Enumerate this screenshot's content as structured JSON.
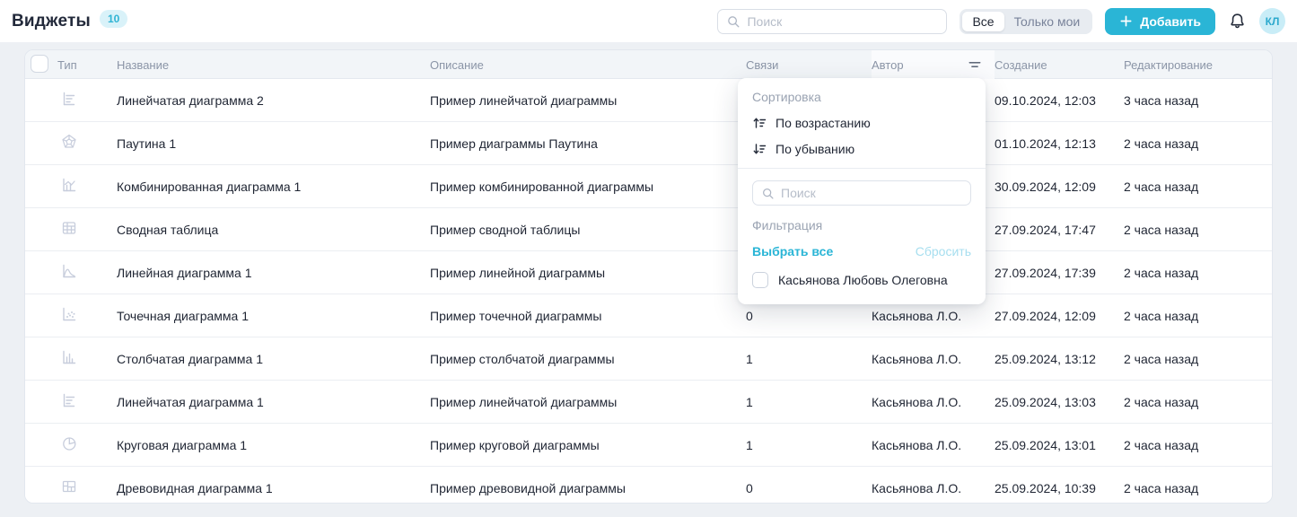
{
  "page": {
    "title": "Виджеты",
    "count_badge": "10"
  },
  "topbar": {
    "search_placeholder": "Поиск",
    "segmented": {
      "all": "Все",
      "only_mine": "Только мои",
      "active": "Все"
    },
    "add_button": "Добавить",
    "avatar_initials": "КЛ"
  },
  "table": {
    "columns": [
      "Тип",
      "Название",
      "Описание",
      "Связи",
      "Автор",
      "Создание",
      "Редактирование"
    ],
    "rows": [
      {
        "icon": "bar-horizontal-chart-icon",
        "name": "Линейчатая диаграмма 2",
        "description": "Пример линейчатой диаграммы",
        "links": "",
        "author": "",
        "created": "09.10.2024, 12:03",
        "edited": "3 часа назад"
      },
      {
        "icon": "radar-chart-icon",
        "name": "Паутина 1",
        "description": "Пример диаграммы Паутина",
        "links": "",
        "author": "",
        "created": "01.10.2024, 12:13",
        "edited": "2 часа назад"
      },
      {
        "icon": "combo-chart-icon",
        "name": "Комбинированная диаграмма 1",
        "description": "Пример комбинированной диаграммы",
        "links": "",
        "author": "",
        "created": "30.09.2024, 12:09",
        "edited": "2 часа назад"
      },
      {
        "icon": "pivot-table-icon",
        "name": "Сводная таблица",
        "description": "Пример сводной таблицы",
        "links": "",
        "author": "",
        "created": "27.09.2024, 17:47",
        "edited": "2 часа назад"
      },
      {
        "icon": "line-chart-icon",
        "name": "Линейная диаграмма 1",
        "description": "Пример линейной диаграммы",
        "links": "",
        "author": "",
        "created": "27.09.2024, 17:39",
        "edited": "2 часа назад"
      },
      {
        "icon": "scatter-chart-icon",
        "name": "Точечная диаграмма 1",
        "description": "Пример точечной диаграммы",
        "links": "0",
        "author": "Касьянова Л.О.",
        "created": "27.09.2024, 12:09",
        "edited": "2 часа назад"
      },
      {
        "icon": "bar-vertical-chart-icon",
        "name": "Столбчатая диаграмма 1",
        "description": "Пример столбчатой диаграммы",
        "links": "1",
        "author": "Касьянова Л.О.",
        "created": "25.09.2024, 13:12",
        "edited": "2 часа назад"
      },
      {
        "icon": "bar-horizontal-chart-icon",
        "name": "Линейчатая диаграмма 1",
        "description": "Пример линейчатой диаграммы",
        "links": "1",
        "author": "Касьянова Л.О.",
        "created": "25.09.2024, 13:03",
        "edited": "2 часа назад"
      },
      {
        "icon": "pie-chart-icon",
        "name": "Круговая диаграмма 1",
        "description": "Пример круговой диаграммы",
        "links": "1",
        "author": "Касьянова Л.О.",
        "created": "25.09.2024, 13:01",
        "edited": "2 часа назад"
      },
      {
        "icon": "treemap-chart-icon",
        "name": "Древовидная диаграмма 1",
        "description": "Пример древовидной диаграммы",
        "links": "0",
        "author": "Касьянова Л.О.",
        "created": "25.09.2024, 10:39",
        "edited": "2 часа назад"
      }
    ]
  },
  "filter_dropdown": {
    "sort_label": "Сортировка",
    "sort_asc": "По возрастанию",
    "sort_desc": "По убыванию",
    "search_placeholder": "Поиск",
    "filter_label": "Фильтрация",
    "select_all": "Выбрать все",
    "reset": "Сбросить",
    "options": [
      {
        "label": "Касьянова Любовь Олеговна",
        "checked": false
      }
    ]
  },
  "colors": {
    "accent": "#2AB5D6",
    "accent_light": "#D9F2F9",
    "reset_disabled": "#A6DEEF",
    "header_text": "#8B95A7",
    "body_text": "#1F2533"
  }
}
